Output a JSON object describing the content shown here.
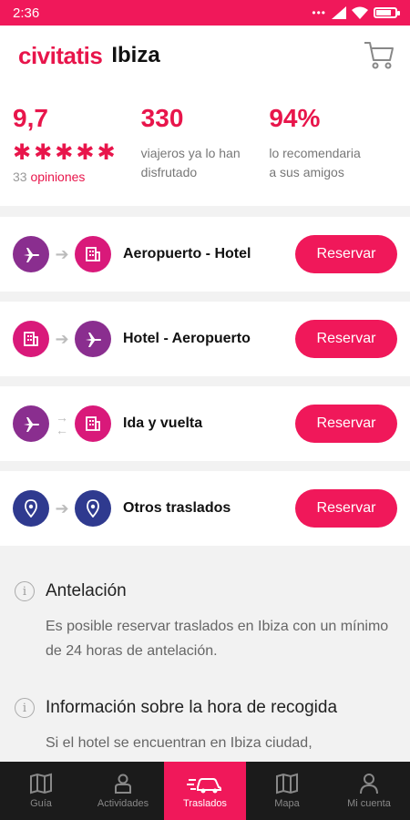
{
  "status_bar": {
    "time": "2:36",
    "dots": "•••"
  },
  "header": {
    "brand": "civitatis",
    "city": "Ibiza"
  },
  "stats": {
    "rating": "9,7",
    "stars": 5,
    "opinions_count": "33",
    "opinions_label": "opiniones",
    "travellers": "330",
    "travellers_line1": "viajeros ya lo han",
    "travellers_line2": "disfrutado",
    "recommend": "94%",
    "recommend_line1": "lo recomendaria",
    "recommend_line2": "a sus amigos"
  },
  "transfers": [
    {
      "label": "Aeropuerto - Hotel",
      "button": "Reservar",
      "from_icon": "plane-icon",
      "to_icon": "hotel-icon"
    },
    {
      "label": "Hotel - Aeropuerto",
      "button": "Reservar",
      "from_icon": "hotel-icon",
      "to_icon": "plane-icon"
    },
    {
      "label": "Ida y vuelta",
      "button": "Reservar",
      "from_icon": "plane-icon",
      "to_icon": "hotel-icon"
    },
    {
      "label": "Otros traslados",
      "button": "Reservar",
      "from_icon": "location-pin-icon",
      "to_icon": "location-pin-icon"
    }
  ],
  "info": {
    "section1_title": "Antelación",
    "section1_text": "Es posible reservar traslados en Ibiza con un mínimo de 24 horas de antelación.",
    "section2_title": "Información sobre la hora de recogida",
    "section2_text": "Si el hotel se encuentran en Ibiza ciudad,"
  },
  "tabs": [
    {
      "label": "Guía",
      "icon": "map-guide-icon"
    },
    {
      "label": "Actividades",
      "icon": "person-icon"
    },
    {
      "label": "Traslados",
      "icon": "car-icon",
      "active": true
    },
    {
      "label": "Mapa",
      "icon": "map-icon"
    },
    {
      "label": "Mi cuenta",
      "icon": "account-icon"
    }
  ],
  "colors": {
    "accent": "#f0185a",
    "purple": "#8a2e8f",
    "magenta": "#d9197a",
    "navy": "#2f3a8f"
  }
}
